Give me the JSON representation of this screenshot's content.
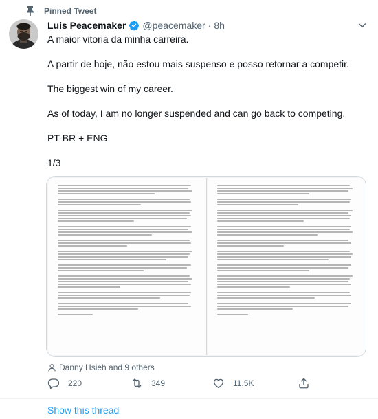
{
  "pinned": {
    "label": "Pinned Tweet",
    "icon": "pin-icon"
  },
  "author": {
    "name": "Luis Peacemaker",
    "handle": "@peacemaker",
    "separator": "·",
    "time": "8h",
    "verified_icon": "verified-badge-icon"
  },
  "tweet": {
    "paragraphs": [
      "A maior vitoria da minha carreira.",
      "A partir de hoje, não estou mais suspenso e posso retornar a competir.",
      "The biggest win of my career.",
      "As of today, I am no longer suspended and can go back to competing.",
      "PT-BR + ENG",
      "1/3"
    ]
  },
  "tagged": {
    "text": "Danny Hsieh and 9 others",
    "icon": "person-icon"
  },
  "actions": {
    "reply_count": "220",
    "retweet_count": "349",
    "like_count": "11.5K"
  },
  "footer": {
    "show_thread": "Show this thread"
  },
  "colors": {
    "accent": "#1d9bf0",
    "secondary_text": "#536471",
    "primary_text": "#0f1419"
  }
}
